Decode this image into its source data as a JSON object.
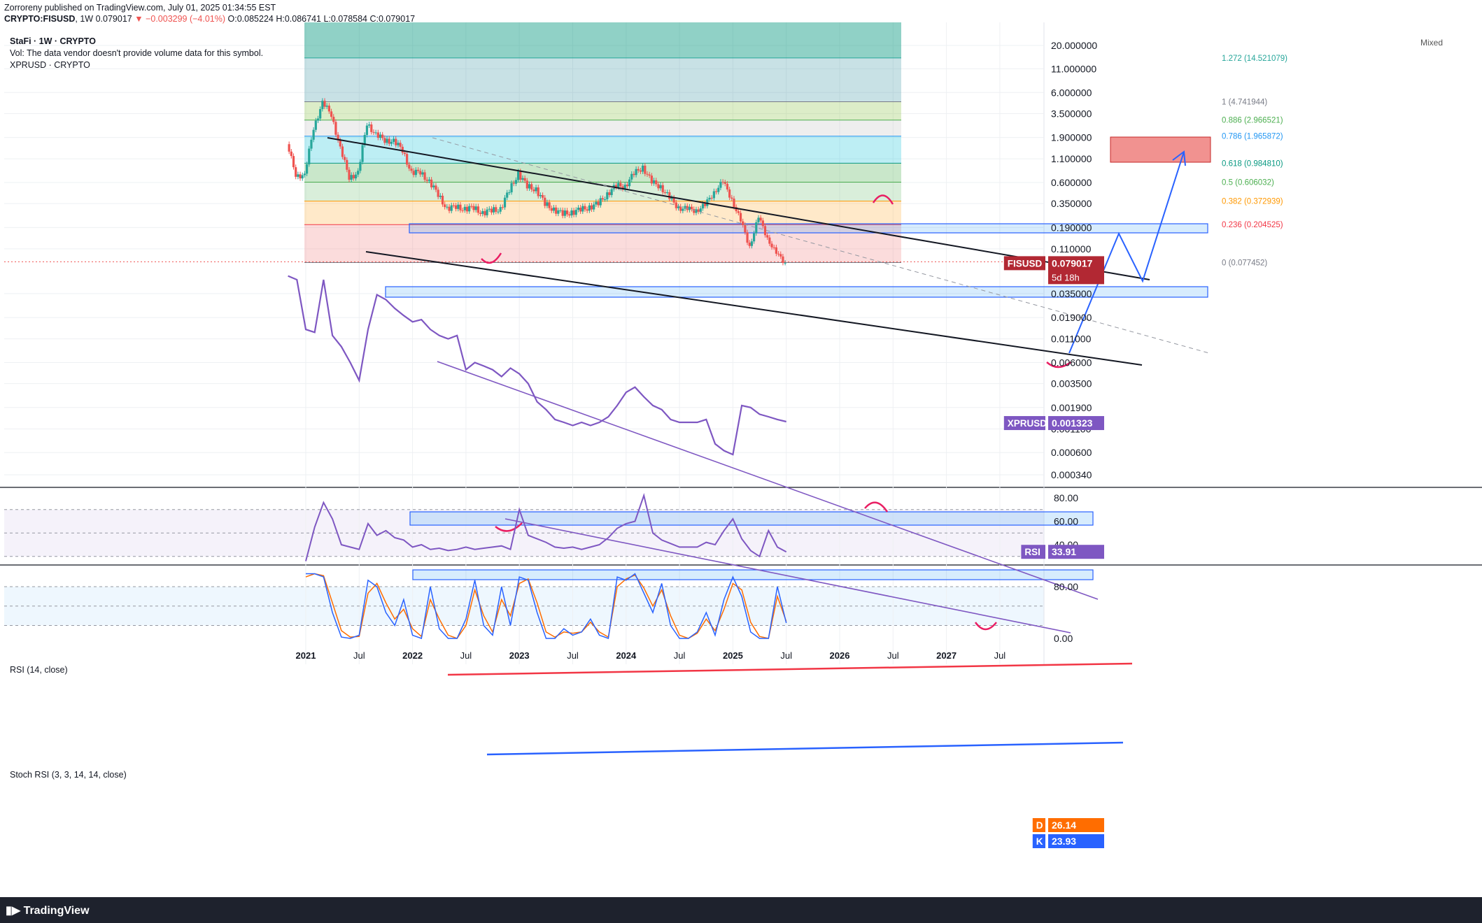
{
  "header": {
    "line1": "Zorroreny published on TradingView.com, July 01, 2025 01:34:55 EST",
    "symbol": "CRYPTO:FISUSD",
    "interval": "1W",
    "price": "0.079017",
    "change": "▼ −0.003299 (−4.01%)",
    "ohlc": "O:0.085224 H:0.086741 L:0.078584 C:0.079017"
  },
  "legend": {
    "title": "StaFi · 1W · CRYPTO",
    "vol": "Vol: The data vendor doesn't provide volume data for this symbol.",
    "compare": "XPRUSD · CRYPTO",
    "mixed": "Mixed"
  },
  "footer": {
    "brand": "TradingView"
  },
  "colors": {
    "up": "#26a69a",
    "down": "#ef5350",
    "xpr": "#7e57c2",
    "rsi": "#7e57c2",
    "stoch_k": "#2962ff",
    "stoch_d": "#ff6d00",
    "fisusd_badge": "#b22833"
  },
  "chart_data": [
    {
      "type": "line",
      "title": "StaFi · 1W · CRYPTO",
      "scale": "log",
      "y_tick_labels": [
        "20.000000",
        "11.000000",
        "6.000000",
        "3.500000",
        "1.900000",
        "1.100000",
        "0.600000",
        "0.350000",
        "0.190000",
        "0.110000",
        "0.035000",
        "0.019000",
        "0.011000",
        "0.006000",
        "0.003500",
        "0.001900",
        "0.001100",
        "0.000600",
        "0.000340"
      ],
      "x_tick_labels": [
        "2021",
        "Jul",
        "2022",
        "Jul",
        "2023",
        "Jul",
        "2024",
        "Jul",
        "2025",
        "Jul",
        "2026",
        "Jul",
        "2027",
        "Jul"
      ],
      "series": [
        {
          "name": "FISUSD",
          "label": "FISUSD",
          "last_value": "0.079017",
          "countdown": "5d 18h",
          "x": [
            "2020-11",
            "2020-12",
            "2021-01",
            "2021-02",
            "2021-03",
            "2021-04",
            "2021-05",
            "2021-06",
            "2021-07",
            "2021-08",
            "2021-09",
            "2021-10",
            "2021-11",
            "2021-12",
            "2022-01",
            "2022-02",
            "2022-03",
            "2022-04",
            "2022-05",
            "2022-06",
            "2022-07",
            "2022-08",
            "2022-09",
            "2022-10",
            "2022-11",
            "2022-12",
            "2023-01",
            "2023-02",
            "2023-03",
            "2023-04",
            "2023-05",
            "2023-06",
            "2023-07",
            "2023-08",
            "2023-09",
            "2023-10",
            "2023-11",
            "2023-12",
            "2024-01",
            "2024-02",
            "2024-03",
            "2024-04",
            "2024-05",
            "2024-06",
            "2024-07",
            "2024-08",
            "2024-09",
            "2024-10",
            "2024-11",
            "2024-12",
            "2025-01",
            "2025-02",
            "2025-03",
            "2025-04",
            "2025-05",
            "2025-06",
            "2025-07"
          ],
          "values": [
            1.6,
            0.75,
            0.7,
            2.5,
            4.5,
            3.5,
            1.4,
            0.7,
            0.75,
            2.8,
            2.0,
            1.8,
            1.7,
            1.4,
            0.75,
            0.8,
            0.6,
            0.45,
            0.3,
            0.33,
            0.3,
            0.32,
            0.27,
            0.3,
            0.3,
            0.5,
            0.75,
            0.55,
            0.5,
            0.35,
            0.3,
            0.27,
            0.28,
            0.3,
            0.32,
            0.35,
            0.45,
            0.55,
            0.55,
            0.75,
            0.9,
            0.6,
            0.55,
            0.4,
            0.32,
            0.3,
            0.3,
            0.33,
            0.48,
            0.6,
            0.4,
            0.22,
            0.12,
            0.24,
            0.15,
            0.095,
            0.079
          ]
        },
        {
          "name": "XPRUSD",
          "label": "XPRUSD",
          "last_value": "0.001323",
          "x": [
            "2020-11",
            "2020-12",
            "2021-01",
            "2021-02",
            "2021-03",
            "2021-04",
            "2021-05",
            "2021-06",
            "2021-07",
            "2021-08",
            "2021-09",
            "2021-10",
            "2021-11",
            "2021-12",
            "2022-01",
            "2022-02",
            "2022-03",
            "2022-04",
            "2022-05",
            "2022-06",
            "2022-07",
            "2022-08",
            "2022-09",
            "2022-10",
            "2022-11",
            "2022-12",
            "2023-01",
            "2023-02",
            "2023-03",
            "2023-04",
            "2023-05",
            "2023-06",
            "2023-07",
            "2023-08",
            "2023-09",
            "2023-10",
            "2023-11",
            "2023-12",
            "2024-01",
            "2024-02",
            "2024-03",
            "2024-04",
            "2024-05",
            "2024-06",
            "2024-07",
            "2024-08",
            "2024-09",
            "2024-10",
            "2024-11",
            "2024-12",
            "2025-01",
            "2025-02",
            "2025-03",
            "2025-04",
            "2025-05",
            "2025-06",
            "2025-07"
          ],
          "values": [
            0.055,
            0.05,
            0.014,
            0.013,
            0.05,
            0.012,
            0.009,
            0.006,
            0.0038,
            0.014,
            0.034,
            0.03,
            0.024,
            0.02,
            0.017,
            0.018,
            0.014,
            0.012,
            0.011,
            0.012,
            0.005,
            0.006,
            0.0055,
            0.005,
            0.0042,
            0.0052,
            0.0045,
            0.0035,
            0.0022,
            0.0018,
            0.0014,
            0.0013,
            0.0012,
            0.0013,
            0.0012,
            0.0013,
            0.0015,
            0.002,
            0.0028,
            0.0032,
            0.0025,
            0.002,
            0.0018,
            0.0014,
            0.0013,
            0.0013,
            0.0013,
            0.0014,
            0.00075,
            0.00063,
            0.00057,
            0.002,
            0.0019,
            0.0016,
            0.0015,
            0.0014,
            0.001323
          ]
        }
      ],
      "fib_levels": [
        {
          "ratio": 1.272,
          "value": 14.521079,
          "label": "1.272 (14.521079)",
          "color": "#26a69a"
        },
        {
          "ratio": 1,
          "value": 4.741944,
          "label": "1 (4.741944)",
          "color": "#787b86"
        },
        {
          "ratio": 0.886,
          "value": 2.966521,
          "label": "0.886 (2.966521)",
          "color": "#4caf50"
        },
        {
          "ratio": 0.786,
          "value": 1.965872,
          "label": "0.786 (1.965872)",
          "color": "#2196f3"
        },
        {
          "ratio": 0.618,
          "value": 0.98481,
          "label": "0.618 (0.984810)",
          "color": "#089981"
        },
        {
          "ratio": 0.5,
          "value": 0.606032,
          "label": "0.5 (0.606032)",
          "color": "#4caf50"
        },
        {
          "ratio": 0.382,
          "value": 0.372939,
          "label": "0.382 (0.372939)",
          "color": "#ff9800"
        },
        {
          "ratio": 0.236,
          "value": 0.204525,
          "label": "0.236 (0.204525)",
          "color": "#f23645"
        },
        {
          "ratio": 0,
          "value": 0.077452,
          "label": "0 (0.077452)",
          "color": "#787b86"
        }
      ]
    },
    {
      "type": "line",
      "title": "RSI (14, close)",
      "y_tick_labels": [
        "80.00",
        "60.00",
        "40.00"
      ],
      "ylim": [
        20,
        86
      ],
      "bands": [
        30,
        50,
        70
      ],
      "series": [
        {
          "name": "RSI",
          "label": "RSI",
          "last_value": "33.91",
          "x": [
            "2021-01",
            "2021-02",
            "2021-03",
            "2021-04",
            "2021-05",
            "2021-06",
            "2021-07",
            "2021-08",
            "2021-09",
            "2021-10",
            "2021-11",
            "2021-12",
            "2022-01",
            "2022-02",
            "2022-03",
            "2022-04",
            "2022-05",
            "2022-06",
            "2022-07",
            "2022-08",
            "2022-09",
            "2022-10",
            "2022-11",
            "2022-12",
            "2023-01",
            "2023-02",
            "2023-03",
            "2023-04",
            "2023-05",
            "2023-06",
            "2023-07",
            "2023-08",
            "2023-09",
            "2023-10",
            "2023-11",
            "2023-12",
            "2024-01",
            "2024-02",
            "2024-03",
            "2024-04",
            "2024-05",
            "2024-06",
            "2024-07",
            "2024-08",
            "2024-09",
            "2024-10",
            "2024-11",
            "2024-12",
            "2025-01",
            "2025-02",
            "2025-03",
            "2025-04",
            "2025-05",
            "2025-06",
            "2025-07"
          ],
          "values": [
            26,
            55,
            76,
            62,
            40,
            38,
            36,
            58,
            48,
            52,
            46,
            44,
            38,
            40,
            36,
            37,
            35,
            36,
            38,
            36,
            37,
            38,
            39,
            36,
            70,
            48,
            45,
            42,
            38,
            37,
            38,
            36,
            38,
            40,
            46,
            54,
            58,
            60,
            82,
            50,
            44,
            41,
            38,
            38,
            38,
            42,
            40,
            52,
            62,
            45,
            35,
            30,
            52,
            38,
            33.91
          ]
        }
      ]
    },
    {
      "type": "line",
      "title": "Stoch RSI (3, 3, 14, 14, close)",
      "y_tick_labels": [
        "80.00",
        "0.00"
      ],
      "ylim": [
        -5,
        110
      ],
      "bands": [
        20,
        50,
        80
      ],
      "series": [
        {
          "name": "K",
          "label": "K",
          "last_value": "23.93",
          "x": [
            "2021-01",
            "2021-02",
            "2021-03",
            "2021-04",
            "2021-05",
            "2021-06",
            "2021-07",
            "2021-08",
            "2021-09",
            "2021-10",
            "2021-11",
            "2021-12",
            "2022-01",
            "2022-02",
            "2022-03",
            "2022-04",
            "2022-05",
            "2022-06",
            "2022-07",
            "2022-08",
            "2022-09",
            "2022-10",
            "2022-11",
            "2022-12",
            "2023-01",
            "2023-02",
            "2023-03",
            "2023-04",
            "2023-05",
            "2023-06",
            "2023-07",
            "2023-08",
            "2023-09",
            "2023-10",
            "2023-11",
            "2023-12",
            "2024-01",
            "2024-02",
            "2024-03",
            "2024-04",
            "2024-05",
            "2024-06",
            "2024-07",
            "2024-08",
            "2024-09",
            "2024-10",
            "2024-11",
            "2024-12",
            "2025-01",
            "2025-02",
            "2025-03",
            "2025-04",
            "2025-05",
            "2025-06",
            "2025-07"
          ],
          "values": [
            100,
            100,
            95,
            40,
            2,
            0,
            5,
            90,
            80,
            40,
            20,
            60,
            5,
            0,
            80,
            15,
            0,
            0,
            30,
            90,
            20,
            5,
            80,
            20,
            95,
            90,
            40,
            0,
            0,
            15,
            5,
            10,
            30,
            5,
            0,
            95,
            90,
            100,
            70,
            40,
            85,
            20,
            0,
            0,
            10,
            40,
            5,
            60,
            95,
            65,
            10,
            0,
            0,
            80,
            23.93
          ]
        },
        {
          "name": "D",
          "label": "D",
          "last_value": "26.14",
          "x": [
            "2021-01",
            "2021-02",
            "2021-03",
            "2021-04",
            "2021-05",
            "2021-06",
            "2021-07",
            "2021-08",
            "2021-09",
            "2021-10",
            "2021-11",
            "2021-12",
            "2022-01",
            "2022-02",
            "2022-03",
            "2022-04",
            "2022-05",
            "2022-06",
            "2022-07",
            "2022-08",
            "2022-09",
            "2022-10",
            "2022-11",
            "2022-12",
            "2023-01",
            "2023-02",
            "2023-03",
            "2023-04",
            "2023-05",
            "2023-06",
            "2023-07",
            "2023-08",
            "2023-09",
            "2023-10",
            "2023-11",
            "2023-12",
            "2024-01",
            "2024-02",
            "2024-03",
            "2024-04",
            "2024-05",
            "2024-06",
            "2024-07",
            "2024-08",
            "2024-09",
            "2024-10",
            "2024-11",
            "2024-12",
            "2025-01",
            "2025-02",
            "2025-03",
            "2025-04",
            "2025-05",
            "2025-06",
            "2025-07"
          ],
          "values": [
            95,
            100,
            97,
            55,
            12,
            2,
            3,
            70,
            85,
            55,
            30,
            45,
            15,
            3,
            60,
            30,
            5,
            0,
            20,
            75,
            35,
            10,
            60,
            35,
            85,
            92,
            55,
            10,
            2,
            10,
            8,
            10,
            25,
            10,
            2,
            80,
            92,
            98,
            78,
            50,
            75,
            35,
            5,
            0,
            8,
            30,
            12,
            45,
            85,
            75,
            25,
            3,
            0,
            65,
            26.14
          ]
        }
      ]
    }
  ]
}
